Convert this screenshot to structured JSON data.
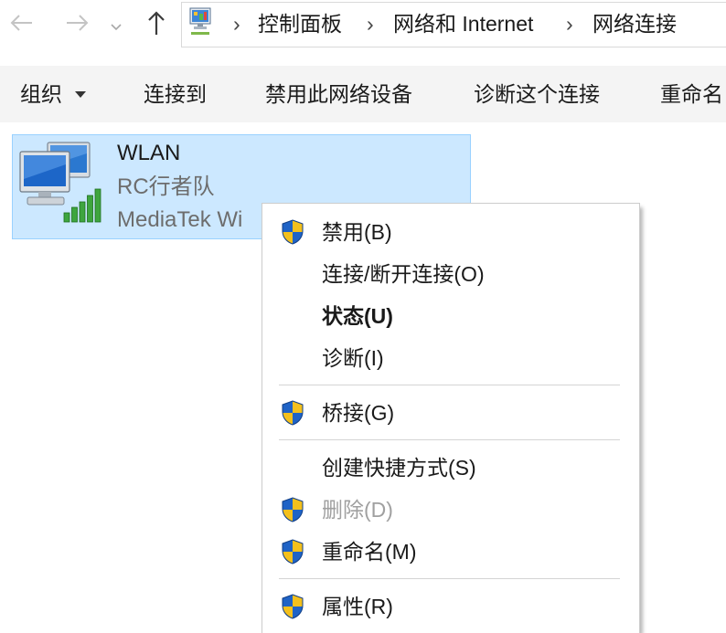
{
  "nav": {
    "back_icon": "arrow-left-icon",
    "forward_icon": "arrow-right-icon",
    "recent_locations_icon": "chevron-down-icon",
    "up_icon": "arrow-up-icon"
  },
  "address_bar": {
    "location_icon": "control-panel-icon",
    "separator": "›",
    "breadcrumbs": [
      "控制面板",
      "网络和 Internet",
      "网络连接"
    ]
  },
  "toolbar": {
    "organize": {
      "label": "组织",
      "icon": "caret-down-icon"
    },
    "commands": [
      "连接到",
      "禁用此网络设备",
      "诊断这个连接",
      "重命名"
    ]
  },
  "connection": {
    "name": "WLAN",
    "network": "RC行者队",
    "adapter": "MediaTek Wi",
    "icon": "wireless-adapter-icon",
    "signal_bars": 5,
    "signal_bars_max": 5,
    "selected": true
  },
  "context_menu": {
    "shield_icon": "uac-shield-icon",
    "groups": [
      {
        "items": [
          {
            "label": "禁用(B)",
            "shield": true
          },
          {
            "label": "连接/断开连接(O)",
            "shield": false
          },
          {
            "label": "状态(U)",
            "shield": false,
            "default": true
          },
          {
            "label": "诊断(I)",
            "shield": false
          }
        ]
      },
      {
        "items": [
          {
            "label": "桥接(G)",
            "shield": true
          }
        ]
      },
      {
        "items": [
          {
            "label": "创建快捷方式(S)",
            "shield": false
          },
          {
            "label": "删除(D)",
            "shield": true,
            "disabled": true
          },
          {
            "label": "重命名(M)",
            "shield": true
          }
        ]
      },
      {
        "items": [
          {
            "label": "属性(R)",
            "shield": true
          }
        ]
      }
    ]
  },
  "colors": {
    "selection_background": "#cce8ff",
    "selection_border": "#99d1ff",
    "toolbar_background": "#f4f4f4",
    "secondary_text": "#6d6d6d",
    "disabled_text": "#a0a0a0",
    "signal_green": "#3ea53e"
  }
}
